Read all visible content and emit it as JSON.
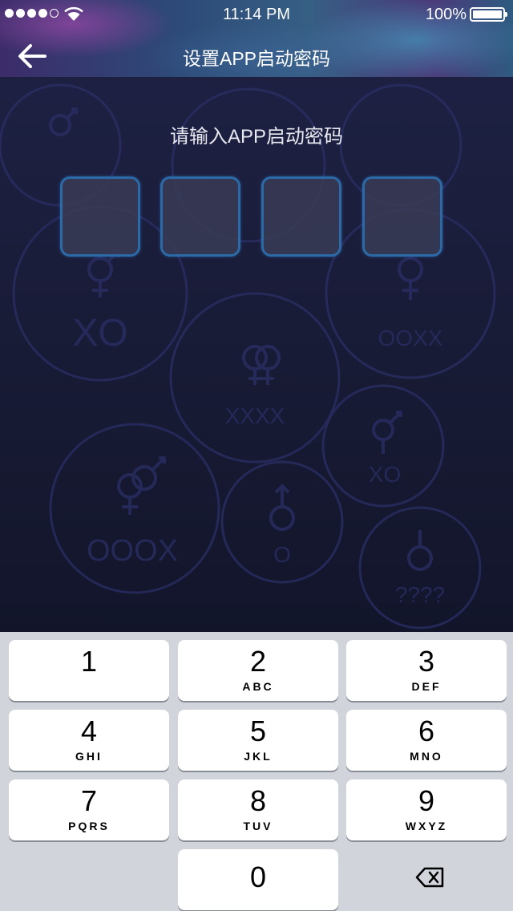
{
  "status_bar": {
    "time": "11:14 PM",
    "battery": "100%"
  },
  "nav": {
    "title": "设置APP启动密码",
    "back_icon": "arrow-left-icon"
  },
  "prompt": "请输入APP启动密码",
  "code_boxes": [
    "",
    "",
    "",
    ""
  ],
  "background_labels": [
    "XO",
    "XXXX",
    "OOXX",
    "XO",
    "OOOX",
    "O",
    "????"
  ],
  "keypad": {
    "keys": [
      {
        "digit": "1",
        "letters": ""
      },
      {
        "digit": "2",
        "letters": "ABC"
      },
      {
        "digit": "3",
        "letters": "DEF"
      },
      {
        "digit": "4",
        "letters": "GHI"
      },
      {
        "digit": "5",
        "letters": "JKL"
      },
      {
        "digit": "6",
        "letters": "MNO"
      },
      {
        "digit": "7",
        "letters": "PQRS"
      },
      {
        "digit": "8",
        "letters": "TUV"
      },
      {
        "digit": "9",
        "letters": "WXYZ"
      },
      {
        "digit": "0",
        "letters": ""
      }
    ],
    "delete_icon": "backspace-icon"
  },
  "colors": {
    "box_border": "#2b6aa7",
    "box_fill": "#3a3c56",
    "keypad_bg": "#d1d4da"
  }
}
